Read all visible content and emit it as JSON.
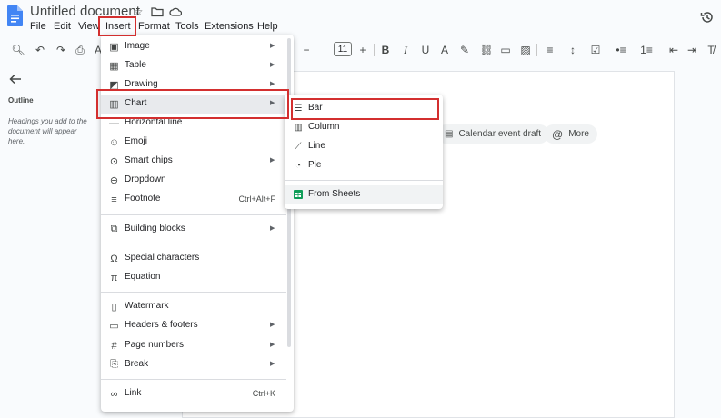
{
  "app": {
    "title": "Untitled document",
    "menus": [
      "File",
      "Edit",
      "View",
      "Insert",
      "Format",
      "Tools",
      "Extensions",
      "Help"
    ]
  },
  "toolbar": {
    "font_size": "11",
    "minus": "−",
    "plus": "+"
  },
  "outline": {
    "title": "Outline",
    "hint": "Headings you add to the document will appear here."
  },
  "page": {
    "chips": [
      "Calendar event draft",
      "More"
    ]
  },
  "insert_menu": {
    "groups": [
      [
        {
          "label": "Image",
          "icon": "image-icon",
          "submenu": true
        },
        {
          "label": "Table",
          "icon": "table-icon",
          "submenu": true
        },
        {
          "label": "Drawing",
          "icon": "drawing-icon",
          "submenu": true
        },
        {
          "label": "Chart",
          "icon": "chart-icon",
          "submenu": true
        },
        {
          "label": "Horizontal line",
          "icon": "horizontal-line-icon",
          "submenu": false
        },
        {
          "label": "Emoji",
          "icon": "emoji-icon",
          "submenu": false
        },
        {
          "label": "Smart chips",
          "icon": "smart-chips-icon",
          "submenu": true
        },
        {
          "label": "Dropdown",
          "icon": "dropdown-icon",
          "submenu": false
        },
        {
          "label": "Footnote",
          "icon": "footnote-icon",
          "shortcut": "Ctrl+Alt+F"
        }
      ],
      [
        {
          "label": "Building blocks",
          "icon": "building-blocks-icon",
          "submenu": true
        }
      ],
      [
        {
          "label": "Special characters",
          "icon": "omega-icon",
          "submenu": false
        },
        {
          "label": "Equation",
          "icon": "pi-icon",
          "submenu": false
        }
      ],
      [
        {
          "label": "Watermark",
          "icon": "watermark-icon",
          "submenu": false
        },
        {
          "label": "Headers & footers",
          "icon": "headers-footers-icon",
          "submenu": true
        },
        {
          "label": "Page numbers",
          "icon": "hash-icon",
          "submenu": true
        },
        {
          "label": "Break",
          "icon": "break-icon",
          "submenu": true
        }
      ],
      [
        {
          "label": "Link",
          "icon": "link-icon",
          "shortcut": "Ctrl+K"
        }
      ]
    ]
  },
  "chart_submenu": {
    "items": [
      {
        "label": "Bar",
        "icon": "bar-chart-icon"
      },
      {
        "label": "Column",
        "icon": "column-chart-icon"
      },
      {
        "label": "Line",
        "icon": "line-chart-icon"
      },
      {
        "label": "Pie",
        "icon": "pie-chart-icon"
      }
    ],
    "from_sheets": {
      "label": "From Sheets",
      "icon": "sheets-icon"
    }
  },
  "colors": {
    "highlight": "#d32f2f",
    "docs_blue": "#4285f4",
    "sheets_green": "#0f9d58"
  }
}
